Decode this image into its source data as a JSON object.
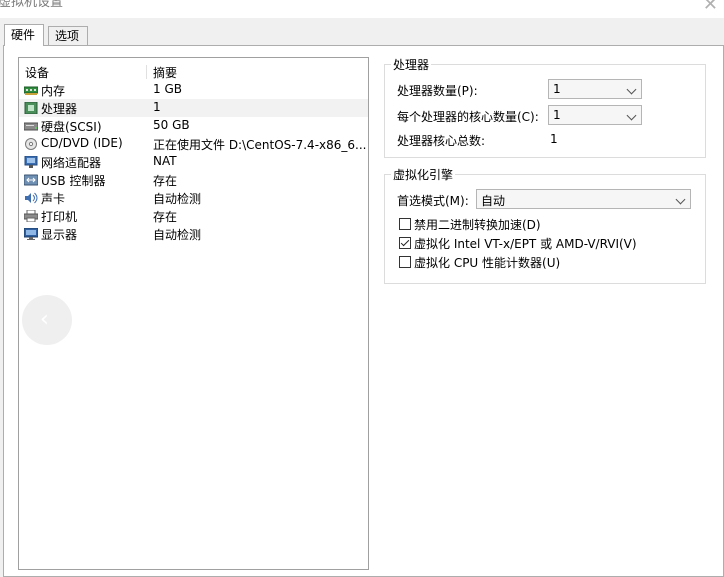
{
  "window": {
    "title": "虚拟机设置",
    "close_glyph": "✕"
  },
  "tabs": [
    {
      "label": "硬件",
      "active": true
    },
    {
      "label": "选项",
      "active": false
    }
  ],
  "device_list": {
    "columns": [
      "设备",
      "摘要"
    ],
    "rows": [
      {
        "device": "内存",
        "summary": "1 GB",
        "icon": "memory-icon",
        "selected": false
      },
      {
        "device": "处理器",
        "summary": "1",
        "icon": "processor-icon",
        "selected": true
      },
      {
        "device": "硬盘(SCSI)",
        "summary": "50 GB",
        "icon": "hard-disk-icon",
        "selected": false
      },
      {
        "device": "CD/DVD (IDE)",
        "summary": "正在使用文件 D:\\CentOS-7.4-x86_6...",
        "icon": "cd-dvd-icon",
        "selected": false
      },
      {
        "device": "网络适配器",
        "summary": "NAT",
        "icon": "network-adapter-icon",
        "selected": false
      },
      {
        "device": "USB 控制器",
        "summary": "存在",
        "icon": "usb-controller-icon",
        "selected": false
      },
      {
        "device": "声卡",
        "summary": "自动检测",
        "icon": "sound-card-icon",
        "selected": false
      },
      {
        "device": "打印机",
        "summary": "存在",
        "icon": "printer-icon",
        "selected": false
      },
      {
        "device": "显示器",
        "summary": "自动检测",
        "icon": "display-icon",
        "selected": false
      }
    ]
  },
  "processor": {
    "title": "处理器",
    "count_label": "处理器数量(P):",
    "count_value": "1",
    "cores_label": "每个处理器的核心数量(C):",
    "cores_value": "1",
    "total_label": "处理器核心总数:",
    "total_value": "1"
  },
  "virtualization": {
    "title": "虚拟化引擎",
    "mode_label": "首选模式(M):",
    "mode_value": "自动",
    "options": [
      {
        "label": "禁用二进制转换加速(D)",
        "checked": false
      },
      {
        "label": "虚拟化 Intel VT-x/EPT 或 AMD-V/RVI(V)",
        "checked": true
      },
      {
        "label": "虚拟化 CPU 性能计数器(U)",
        "checked": false
      }
    ]
  },
  "overlay": {
    "back_glyph": "‹"
  },
  "colors": {
    "frame_border": "#adadad",
    "selected_row": "#f2f2f2",
    "panel_bg": "#ffffff"
  }
}
